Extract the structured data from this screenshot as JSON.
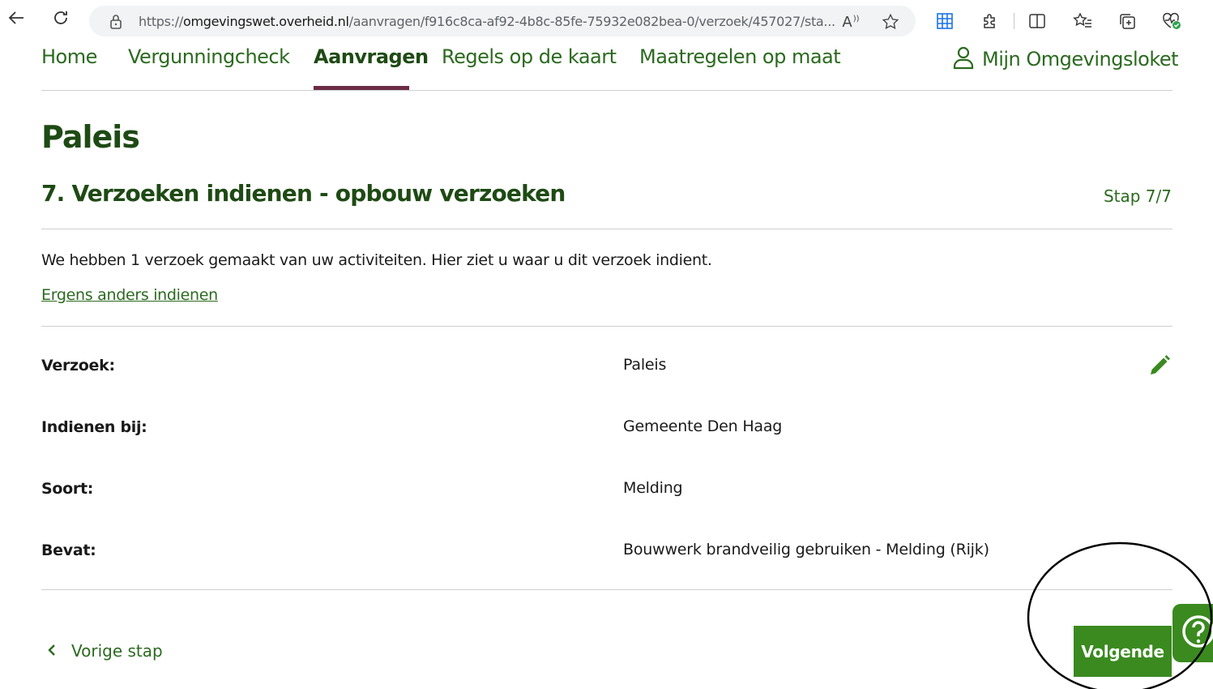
{
  "browser": {
    "url_prefix": "https://",
    "url_domain": "omgevingswet.overheid.nl",
    "url_path": "/aanvragen/f916c8ca-af92-4b8c-85fe-75932e082bea-0/verzoek/457027/sta...",
    "read_aloud_label": "A",
    "icons": [
      "back-arrow-icon",
      "refresh-icon",
      "lock-icon",
      "read-aloud-icon",
      "favorite-star-icon",
      "apps-grid-icon",
      "extensions-icon",
      "split-screen-icon",
      "favorites-icon",
      "collections-icon",
      "browser-essentials-icon"
    ]
  },
  "nav": {
    "items": [
      {
        "label": "Home"
      },
      {
        "label": "Vergunningcheck"
      },
      {
        "label": "Aanvragen"
      },
      {
        "label": "Regels op de kaart"
      },
      {
        "label": "Maatregelen op maat"
      }
    ],
    "active_index": 2,
    "login_label": "Mijn Omgevingsloket"
  },
  "page": {
    "title": "Paleis",
    "step_title": "7. Verzoeken indienen - opbouw verzoeken",
    "step_count": "Stap 7/7",
    "intro": "We hebben 1 verzoek gemaakt van uw activiteiten. Hier ziet u waar u dit verzoek indient.",
    "alt_link": "Ergens anders indienen",
    "details": [
      {
        "label": "Verzoek:",
        "value": "Paleis"
      },
      {
        "label": "Indienen bij:",
        "value": "Gemeente Den Haag"
      },
      {
        "label": "Soort:",
        "value": "Melding"
      },
      {
        "label": "Bevat:",
        "value": "Bouwwerk brandveilig gebruiken - Melding (Rijk)"
      }
    ]
  },
  "footer": {
    "back_label": "Vorige stap",
    "next_label": "Volgende",
    "help_icon": "question-circle-icon"
  },
  "colors": {
    "brand_green_dark": "#1e4a14",
    "brand_green": "#2b6a1f",
    "button_green": "#3a8a1f",
    "active_underline": "#6b2b46"
  }
}
